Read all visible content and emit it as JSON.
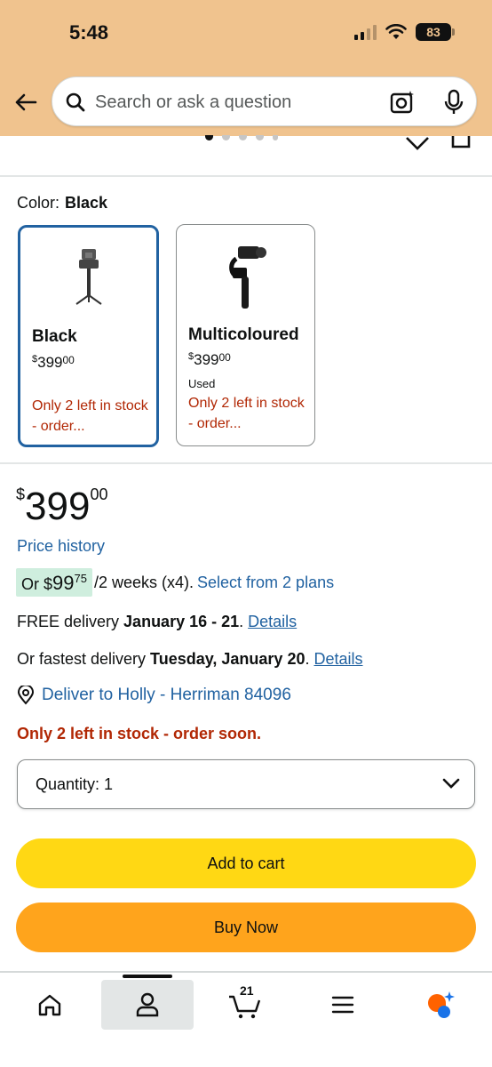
{
  "status_bar": {
    "time": "5:48",
    "battery": "83"
  },
  "header": {
    "search_placeholder": "Search or ask a question"
  },
  "color": {
    "label": "Color:",
    "selected": "Black",
    "options": [
      {
        "name": "Black",
        "price_symbol": "$",
        "price_whole": "399",
        "price_fraction": "00",
        "condition": "",
        "stock": "Only 2 left in stock - order..."
      },
      {
        "name": "Multicoloured",
        "price_symbol": "$",
        "price_whole": "399",
        "price_fraction": "00",
        "condition": "Used",
        "stock": "Only 2 left in stock - order..."
      }
    ]
  },
  "price": {
    "symbol": "$",
    "whole": "399",
    "fraction": "00",
    "history_link": "Price history"
  },
  "installment": {
    "prefix": "Or $",
    "amount_whole": "99",
    "amount_fraction": "75",
    "period": "/2 weeks (x4).",
    "link": "Select from 2 plans"
  },
  "delivery": {
    "free_prefix": "FREE delivery ",
    "free_date": "January 16 - 21",
    "free_suffix": ". ",
    "free_link": "Details",
    "fast_prefix": "Or fastest delivery ",
    "fast_date": "Tuesday, January 20",
    "fast_suffix": ". ",
    "fast_link": "Details",
    "deliver_to": "Deliver to Holly - Herriman 84096"
  },
  "stock_message": "Only 2 left in stock - order soon.",
  "quantity": {
    "label": "Quantity: 1"
  },
  "buttons": {
    "add_to_cart": "Add to cart",
    "buy_now": "Buy Now"
  },
  "bottom_nav": {
    "cart_count": "21",
    "items": [
      "home-icon",
      "account-icon",
      "cart-icon",
      "menu-icon",
      "rufus-icon"
    ],
    "active": "account-icon"
  },
  "colors": {
    "link": "#2162a1",
    "deal_red": "#b12704",
    "cart_yellow": "#ffd814",
    "buy_orange": "#ffa41c",
    "header_bg": "#f0c38e"
  }
}
